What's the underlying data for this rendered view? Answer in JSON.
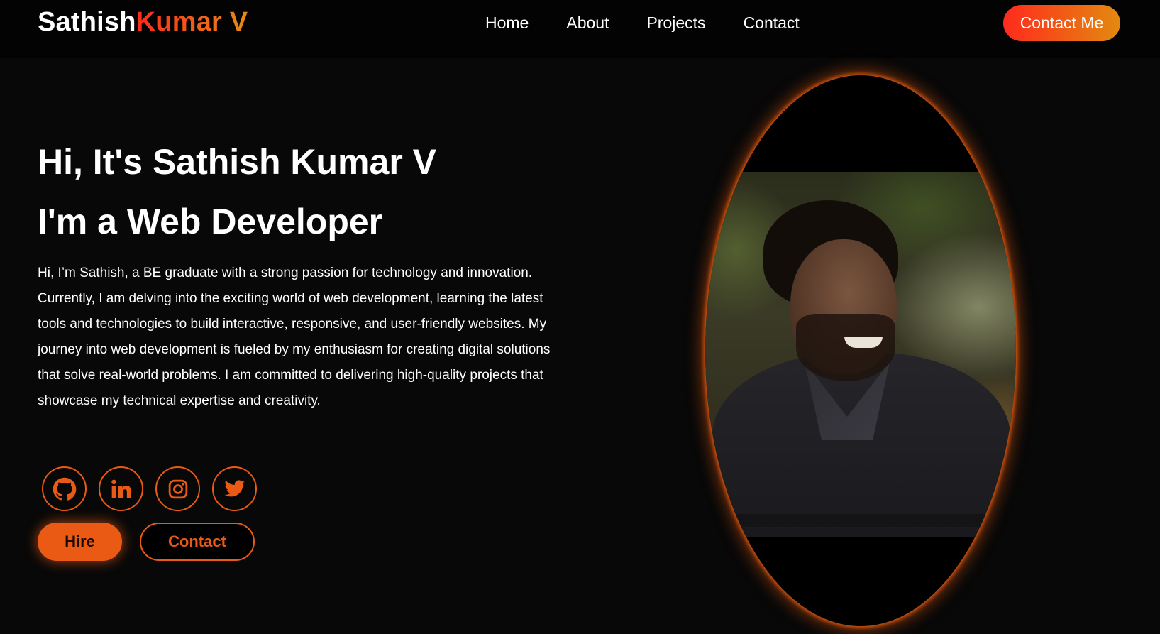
{
  "brand": {
    "first": "Sathish",
    "last": "Kumar V",
    "accent_start": "#ff2a1c",
    "accent_end": "#e88a12"
  },
  "nav": {
    "items": [
      {
        "label": "Home"
      },
      {
        "label": "About"
      },
      {
        "label": "Projects"
      },
      {
        "label": "Contact"
      }
    ],
    "cta_label": "Contact Me"
  },
  "hero": {
    "greeting": "Hi, It's Sathish Kumar V",
    "role": "I'm a Web Developer",
    "bio": "Hi, I’m Sathish, a BE graduate with a strong passion for technology and innovation. Currently, I am delving into the exciting world of web development, learning the latest tools and technologies to build interactive, responsive, and user-friendly websites. My journey into web development is fueled by my enthusiasm for creating digital solutions that solve real-world problems. I am committed to delivering high-quality projects that showcase my technical expertise and creativity.",
    "socials": [
      {
        "icon": "github-icon"
      },
      {
        "icon": "linkedin-icon"
      },
      {
        "icon": "instagram-icon"
      },
      {
        "icon": "twitter-icon"
      }
    ],
    "hire_label": "Hire",
    "contact_label": "Contact",
    "accent": "#ea5a14"
  },
  "portrait": {
    "icon": "profile-photo"
  }
}
